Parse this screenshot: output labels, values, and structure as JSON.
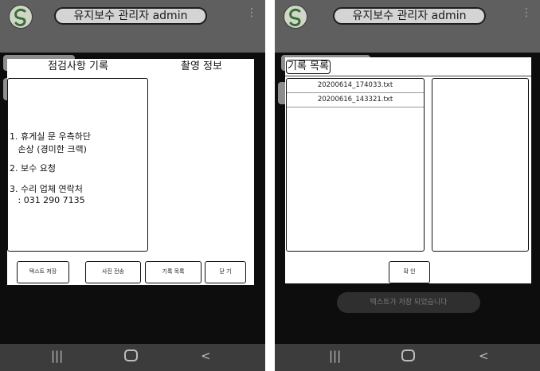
{
  "left_screen": {
    "header": {
      "title": "유지보수 관리자 admin"
    },
    "dialog": {
      "tab_record": "점검사항 기록",
      "tab_photo": "촬영 정보",
      "text_lines": [
        "1. 휴게실 문 우측하단",
        "   손상 (경미한 크랙)",
        "2. 보수 요청",
        "3. 수리 업체 연락처",
        "   : 031 290 7135"
      ],
      "buttons": {
        "save_text": "텍스트 저장",
        "send_photo": "사진 전송",
        "record_list": "기록 목록",
        "close": "닫 기"
      }
    }
  },
  "right_screen": {
    "header": {
      "title": "유지보수 관리자 admin"
    },
    "dialog": {
      "title": "기록 목록",
      "files": [
        "20200614_174033.txt",
        "20200616_143321.txt"
      ],
      "confirm": "확 인"
    },
    "toast": "텍스트가 저장 되었습니다"
  }
}
